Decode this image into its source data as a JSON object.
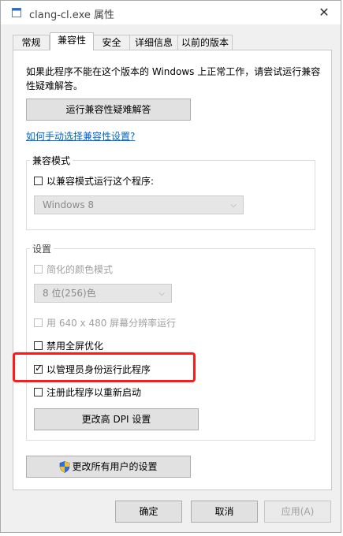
{
  "window": {
    "title": "clang-cl.exe 属性",
    "close_glyph": "✕"
  },
  "tabs": [
    {
      "label": "常规"
    },
    {
      "label": "兼容性"
    },
    {
      "label": "安全"
    },
    {
      "label": "详细信息"
    },
    {
      "label": "以前的版本"
    }
  ],
  "intro_text": "如果此程序不能在这个版本的 Windows 上正常工作，请尝试运行兼容性疑难解答。",
  "troubleshooter_button": "运行兼容性疑难解答",
  "manual_link": "如何手动选择兼容性设置?",
  "compat_mode": {
    "group_label": "兼容模式",
    "checkbox_label": "以兼容模式运行这个程序:",
    "checked": false,
    "os_select_value": "Windows 8"
  },
  "settings": {
    "group_label": "设置",
    "reduced_color_label": "简化的颜色模式",
    "color_select_value": "8 位(256)色",
    "low_res_label": "用 640 x 480 屏幕分辨率运行",
    "disable_fullscreen_label": "禁用全屏优化",
    "run_as_admin_label": "以管理员身份运行此程序",
    "run_as_admin_checked": true,
    "register_restart_label": "注册此程序以重新启动",
    "change_dpi_button": "更改高 DPI 设置"
  },
  "all_users_button": "更改所有用户的设置",
  "footer": {
    "ok_label": "确定",
    "cancel_label": "取消",
    "apply_label": "应用(A)"
  },
  "colors": {
    "highlight_border": "#ff1a1a",
    "link": "#0066cc"
  }
}
